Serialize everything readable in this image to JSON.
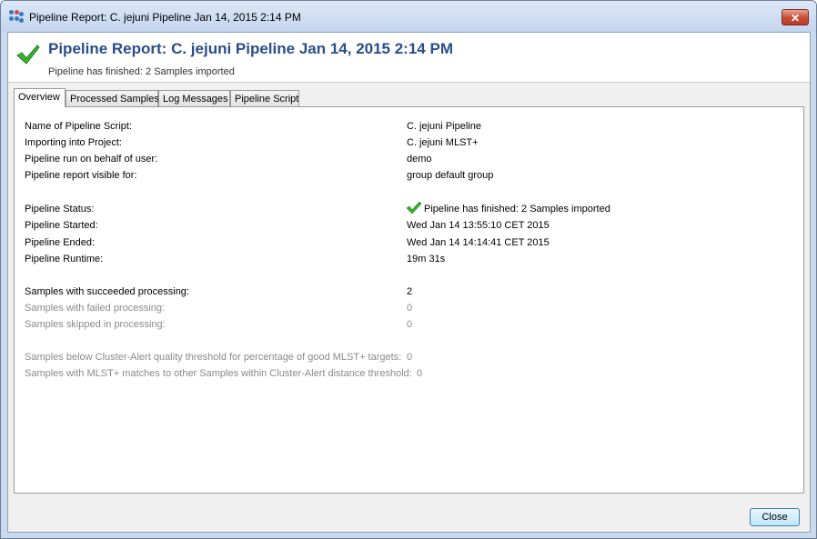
{
  "window": {
    "title": "Pipeline Report: C. jejuni Pipeline Jan 14, 2015 2:14 PM",
    "close_glyph": "✕"
  },
  "header": {
    "title": "Pipeline Report: C. jejuni Pipeline Jan 14, 2015 2:14 PM",
    "subtitle": "Pipeline has finished: 2 Samples imported",
    "icon": "green-check-icon"
  },
  "tabs": [
    {
      "label": "Overview",
      "active": true
    },
    {
      "label": "Processed Samples",
      "active": false
    },
    {
      "label": "Log Messages",
      "active": false
    },
    {
      "label": "Pipeline Script",
      "active": false
    }
  ],
  "overview": {
    "script_name": {
      "label": "Name of Pipeline Script:",
      "value": "C. jejuni Pipeline"
    },
    "project": {
      "label": "Importing into Project:",
      "value": "C. jejuni MLST+"
    },
    "user": {
      "label": "Pipeline run on behalf of user:",
      "value": "demo"
    },
    "visible": {
      "label": "Pipeline report visible for:",
      "value": "group default group"
    },
    "status": {
      "label": "Pipeline Status:",
      "value": "Pipeline has finished: 2 Samples imported"
    },
    "started": {
      "label": "Pipeline Started:",
      "value": "Wed Jan 14 13:55:10 CET 2015"
    },
    "ended": {
      "label": "Pipeline Ended:",
      "value": "Wed Jan 14 14:14:41 CET 2015"
    },
    "runtime": {
      "label": "Pipeline Runtime:",
      "value": "19m 31s"
    },
    "succeeded": {
      "label": "Samples with succeeded processing:",
      "value": "2"
    },
    "failed": {
      "label": "Samples with failed processing:",
      "value": "0"
    },
    "skipped": {
      "label": "Samples skipped in processing:",
      "value": "0"
    },
    "below_threshold": {
      "label": "Samples below Cluster-Alert quality threshold for percentage of good MLST+ targets:",
      "value": "0"
    },
    "mlst_matches": {
      "label": "Samples with MLST+ matches to other Samples within Cluster-Alert distance threshold:",
      "value": "0"
    }
  },
  "footer": {
    "close_label": "Close"
  },
  "colors": {
    "accent_title": "#2a4e8a",
    "check_green": "#3bb52b",
    "dim_text": "#8a8a8a"
  }
}
